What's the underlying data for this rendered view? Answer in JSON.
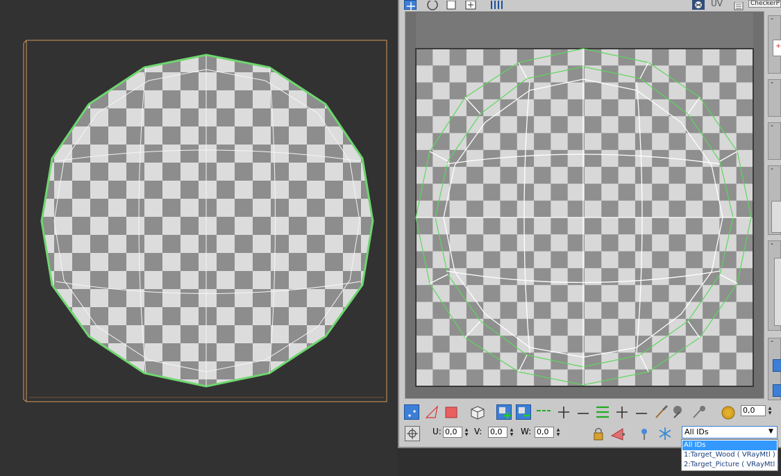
{
  "editor": {
    "uv_label": "UV",
    "checker_map_name": "CheckerP"
  },
  "toolbar": {
    "u_label": "U:",
    "u_value": "0,0",
    "v_label": "V:",
    "v_value": "0,0",
    "w_label": "W:",
    "w_value": "0,0",
    "soft_value": "0,0"
  },
  "material_ids": {
    "selected": "All IDs",
    "options": [
      "All IDs",
      "1:Target_Wood  ( VRayMtl )",
      "2:Target_Picture  ( VRayMtl )"
    ]
  },
  "colors": {
    "selection_blue": "#3d7fd6",
    "uv_edge_green": "#5dd65d",
    "gizmo_orange": "#d49a5c"
  }
}
